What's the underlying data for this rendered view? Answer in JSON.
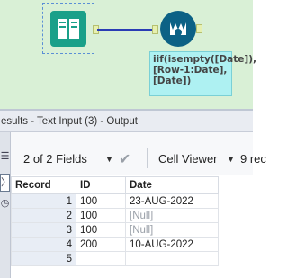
{
  "workflow": {
    "annotation": "iif(isempty([Date]),[Row-1:Date],[Date])"
  },
  "results_panel": {
    "title": "esults - Text Input (3) - Output"
  },
  "toolbar": {
    "fields_label": "2 of 2 Fields",
    "viewer_label": "Cell Viewer",
    "records_label": "9 rec"
  },
  "table": {
    "headers": [
      "Record",
      "ID",
      "Date"
    ],
    "rows": [
      {
        "record": "1",
        "id": "100",
        "date": "23-AUG-2022"
      },
      {
        "record": "2",
        "id": "100",
        "date": "[Null]"
      },
      {
        "record": "3",
        "id": "100",
        "date": "[Null]"
      },
      {
        "record": "4",
        "id": "200",
        "date": "10-AUG-2022"
      },
      {
        "record": "5",
        "id": "",
        "date": ""
      }
    ]
  },
  "colors": {
    "canvas": "#d9f0d6",
    "connector": "#2a3cb5",
    "formula_tool": "#0c6185",
    "input_tool": "#1aa089",
    "annotation": "#aef1f2"
  }
}
